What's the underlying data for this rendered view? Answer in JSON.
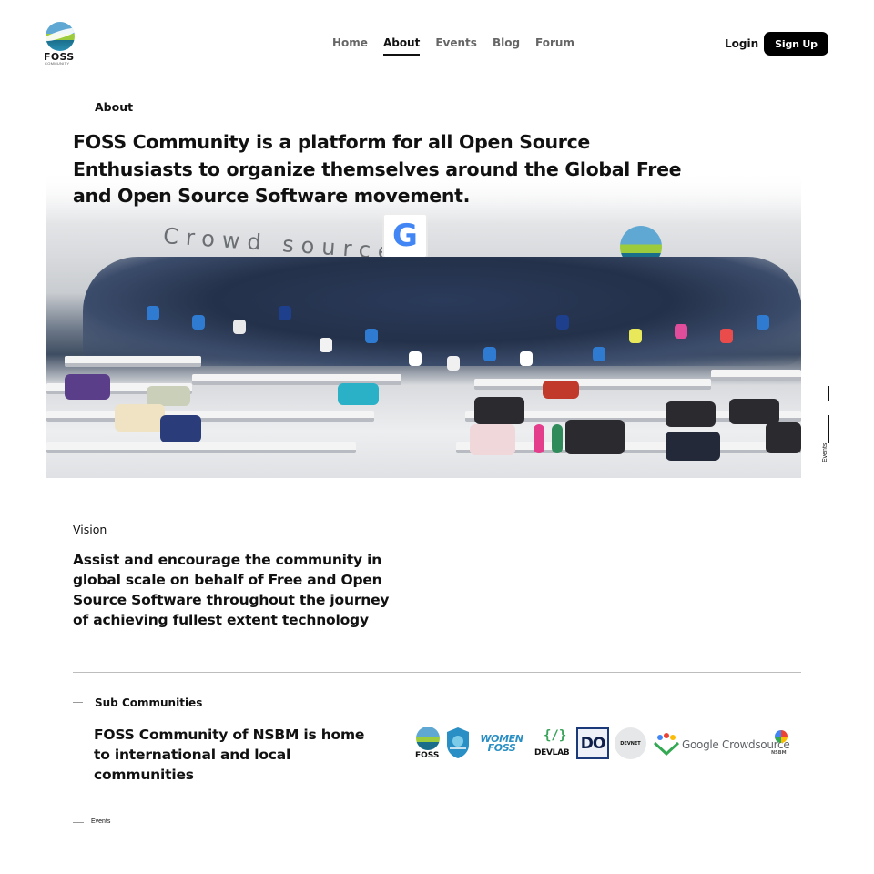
{
  "brand": {
    "name": "FOSS",
    "sub": "COMMUNITY",
    "colors": {
      "sky": "#5fa8d3",
      "grass": "#9ccc3d",
      "sea": "#1a6e8a"
    }
  },
  "nav": {
    "items": [
      "Home",
      "About",
      "Events",
      "Blog",
      "Forum"
    ],
    "active": "About"
  },
  "auth": {
    "login": "Login",
    "signup": "Sign Up"
  },
  "about": {
    "label": "About",
    "title": "FOSS Community is a platform for all Open Source Enthusiasts to organize themselves around the Global Free and Open Source Software movement."
  },
  "hero": {
    "description": "group photo",
    "wall_text": "Crowd source",
    "banner_letter": "G"
  },
  "side": {
    "label": "Events"
  },
  "vision": {
    "label": "Vision",
    "text": "Assist and encourage the community in global scale on behalf of Free and Open Source Software throughout the journey of achieving fullest extent technology"
  },
  "sub_communities": {
    "label": "Sub Communities",
    "text": "FOSS Community of NSBM is home to international and local communities",
    "logos": [
      {
        "name": "FOSS",
        "label": "FOSS"
      },
      {
        "name": "shield",
        "label": ""
      },
      {
        "name": "women-foss",
        "label": "WOMEN FOSS"
      },
      {
        "name": "devlab",
        "label": "DEVLAB"
      },
      {
        "name": "do",
        "label": "DO"
      },
      {
        "name": "devnet",
        "label": "DEVNET"
      },
      {
        "name": "google-crowdsource",
        "label": "Google Crowdsource",
        "sub": "NSBM"
      }
    ]
  },
  "footer": {
    "events_label": "Events"
  }
}
